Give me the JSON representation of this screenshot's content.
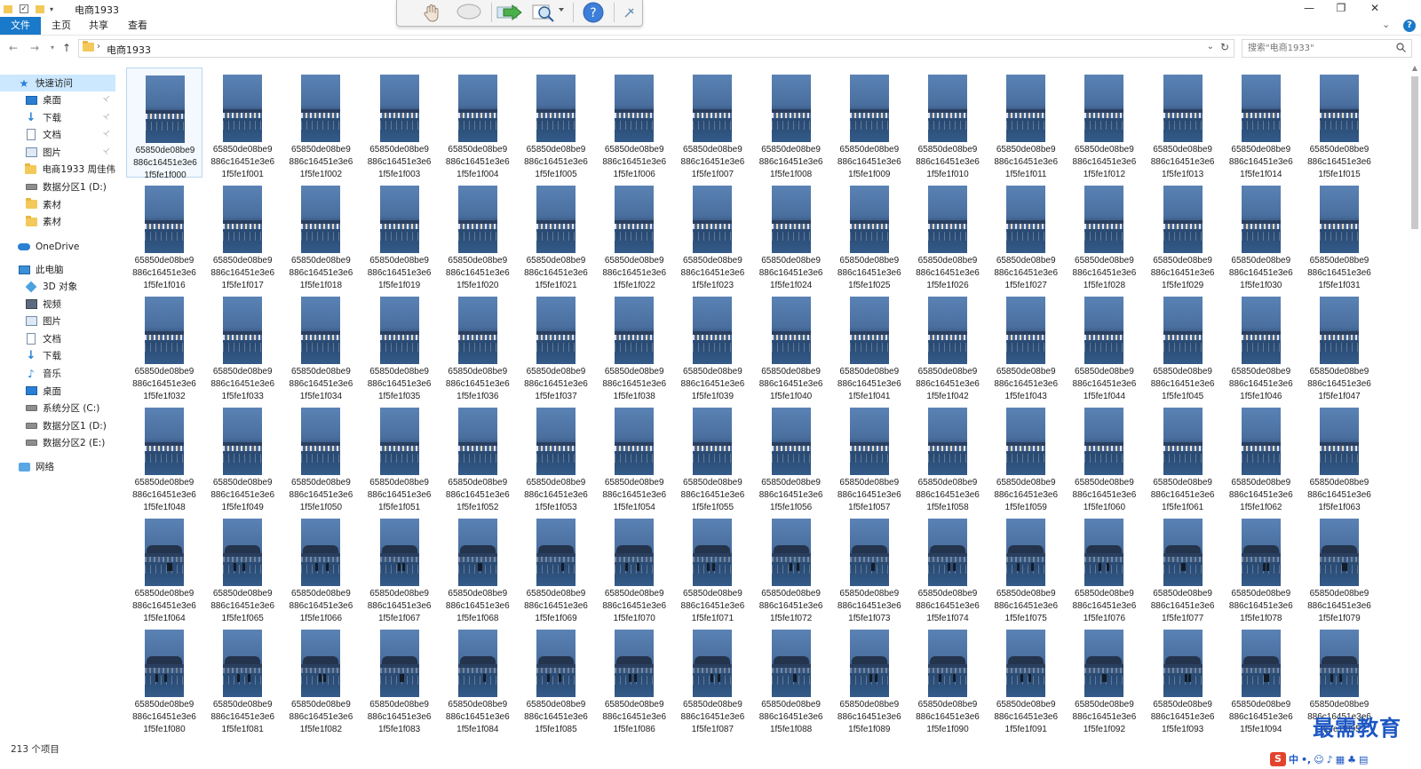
{
  "window": {
    "title": "电商1933",
    "controls": {
      "minimize": "—",
      "maximize": "❐",
      "close": "✕"
    }
  },
  "ribbon": {
    "tabs": [
      {
        "label": "文件",
        "active": true
      },
      {
        "label": "主页",
        "active": false
      },
      {
        "label": "共享",
        "active": false
      },
      {
        "label": "查看",
        "active": false
      }
    ],
    "collapse": "⌄",
    "help": "?"
  },
  "address": {
    "path": "电商1933",
    "separator": "›",
    "search_placeholder": "搜索\"电商1933\""
  },
  "sidebar": {
    "quick_access": "快速访问",
    "items": [
      {
        "label": "桌面",
        "icon": "desktop-icon",
        "pinned": true
      },
      {
        "label": "下载",
        "icon": "download-icon",
        "pinned": true
      },
      {
        "label": "文档",
        "icon": "document-icon",
        "pinned": true
      },
      {
        "label": "图片",
        "icon": "picture-icon",
        "pinned": true
      },
      {
        "label": "电商1933 周佳伟",
        "icon": "folder-icon",
        "pinned": false
      },
      {
        "label": "数据分区1 (D:)",
        "icon": "drive-icon",
        "pinned": false
      },
      {
        "label": "素材",
        "icon": "folder-icon",
        "pinned": false
      },
      {
        "label": "素材",
        "icon": "folder-icon",
        "pinned": false
      }
    ],
    "onedrive": "OneDrive",
    "this_pc": "此电脑",
    "pc_items": [
      {
        "label": "3D 对象",
        "icon": "3d-objects-icon"
      },
      {
        "label": "视频",
        "icon": "video-icon"
      },
      {
        "label": "图片",
        "icon": "picture-icon"
      },
      {
        "label": "文档",
        "icon": "document-icon"
      },
      {
        "label": "下载",
        "icon": "download-icon"
      },
      {
        "label": "音乐",
        "icon": "music-icon"
      },
      {
        "label": "桌面",
        "icon": "desktop-icon"
      },
      {
        "label": "系统分区 (C:)",
        "icon": "drive-icon"
      },
      {
        "label": "数据分区1 (D:)",
        "icon": "drive-icon"
      },
      {
        "label": "数据分区2 (E:)",
        "icon": "drive-icon"
      }
    ],
    "network": "网络"
  },
  "files": {
    "name_line1": "65850de08be9",
    "name_line2": "886c16451e3e6",
    "name_prefix_line3": "1f5fe1f0",
    "numbers": [
      "00",
      "01",
      "02",
      "03",
      "04",
      "05",
      "06",
      "07",
      "08",
      "09",
      "10",
      "11",
      "12",
      "13",
      "14",
      "15",
      "16",
      "17",
      "18",
      "19",
      "20",
      "21",
      "22",
      "23",
      "24",
      "25",
      "26",
      "27",
      "28",
      "29",
      "30",
      "31",
      "32",
      "33",
      "34",
      "35",
      "36",
      "37",
      "38",
      "39",
      "40",
      "41",
      "42",
      "43",
      "44",
      "45",
      "46",
      "47",
      "48",
      "49",
      "50",
      "51",
      "52",
      "53",
      "54",
      "55",
      "56",
      "57",
      "58",
      "59",
      "60",
      "61",
      "62",
      "63",
      "64",
      "65",
      "66",
      "67",
      "68",
      "69",
      "70",
      "71",
      "72",
      "73",
      "74",
      "75",
      "76",
      "77",
      "78",
      "79",
      "80",
      "81",
      "82",
      "83",
      "84",
      "85",
      "86",
      "87",
      "88",
      "89",
      "90",
      "91",
      "92",
      "93",
      "94",
      "95"
    ],
    "selected_index": 0
  },
  "status": {
    "count": "213 个项目"
  },
  "watermark": {
    "text": "最需教育",
    "ime": "中"
  },
  "colors": {
    "accent": "#1979ca",
    "selection": "#cce8ff"
  }
}
